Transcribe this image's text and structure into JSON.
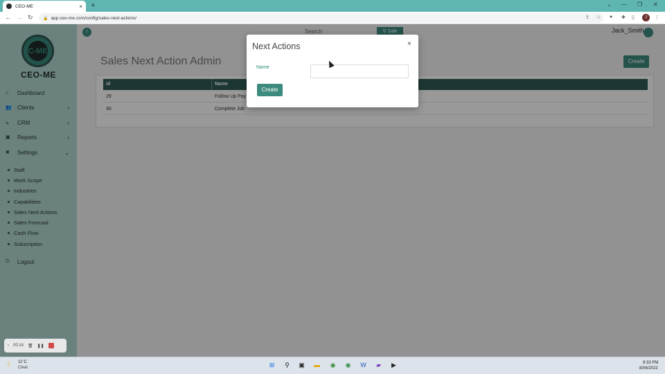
{
  "browser": {
    "tab_title": "CEO-ME",
    "url": "app.ceo-me.com/config/sales-next-actions/",
    "new_tab": "+",
    "profile_initial": "J"
  },
  "sidebar": {
    "logo_mark": "C-ME",
    "logo_text": "CEO-ME",
    "items": [
      {
        "label": "Dashboard",
        "icon": "home-icon"
      },
      {
        "label": "Clients",
        "icon": "users-icon",
        "chevron": "›"
      },
      {
        "label": "CRM",
        "icon": "chart-icon",
        "chevron": "›"
      },
      {
        "label": "Reports",
        "icon": "report-icon",
        "chevron": "›"
      },
      {
        "label": "Settings",
        "icon": "wrench-icon",
        "chevron": "⌄"
      }
    ],
    "sub_items": [
      "Staff",
      "Work Scope",
      "Industries",
      "Capabilities",
      "Sales Next Actions",
      "Sales Forecast",
      "Cash Flow",
      "Subscription"
    ],
    "logout": "Logout"
  },
  "recorder": {
    "time": "00:14"
  },
  "header": {
    "search_placeholder": "Search",
    "search_button": "Sale",
    "user_name": "Jack_Smith"
  },
  "main": {
    "title": "Sales Next Action Admin",
    "create_label": "Create",
    "table": {
      "headers": [
        "id",
        "Name"
      ],
      "rows": [
        {
          "id": "29",
          "name": "Follow Up Pay"
        },
        {
          "id": "30",
          "name": "Complete Job"
        }
      ]
    }
  },
  "modal": {
    "title": "Next Actions",
    "close": "×",
    "name_label": "Name",
    "name_value": "",
    "create_label": "Create"
  },
  "taskbar": {
    "temperature": "11°C",
    "weather": "Clear",
    "time": "8:33 PM",
    "date": "8/06/2022"
  }
}
